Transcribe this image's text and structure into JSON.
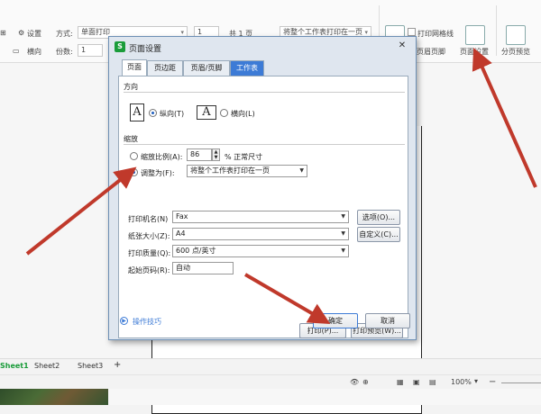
{
  "ribbon": {
    "settings_label": "设置",
    "landscape_label": "横向",
    "mode_label": "方式:",
    "mode_value": "单面打印",
    "copies_label": "份数:",
    "copies_value": "1",
    "page_from": "1",
    "page_total": "共 1 页",
    "fit_value": "将整个工作表打印在一页",
    "gridlines_label": "打印网格线",
    "header_footer_label": "页眉页脚",
    "page_setup_label": "页面设置",
    "page_break_label": "分页预览"
  },
  "dialog": {
    "logo": "S",
    "title": "页面设置",
    "close": "✕",
    "tabs": [
      "页面",
      "页边距",
      "页眉/页脚",
      "工作表"
    ],
    "orientation": {
      "label": "方向",
      "portrait": "纵向(T)",
      "landscape": "横向(L)",
      "icon_letter": "A"
    },
    "scaling": {
      "label": "缩放",
      "scale_label": "缩放比例(A):",
      "scale_value": "86",
      "scale_suffix": "% 正常尺寸",
      "fit_label": "调整为(F):",
      "fit_value": "将整个工作表打印在一页"
    },
    "printer": {
      "name_label": "打印机名(N)",
      "name_value": "Fax",
      "options_btn": "选项(O)...",
      "paper_label": "纸张大小(Z):",
      "paper_value": "A4",
      "custom_btn": "自定义(C)...",
      "quality_label": "打印质量(Q):",
      "quality_value": "600 点/英寸",
      "first_page_label": "起始页码(R):",
      "first_page_value": "自动"
    },
    "print_btn": "打印(P)...",
    "preview_btn": "打印预览(W)...",
    "tips_link": "操作技巧",
    "ok_btn": "确定",
    "cancel_btn": "取消"
  },
  "sheets": {
    "tabs": [
      "Sheet1",
      "Sheet2",
      "Sheet3"
    ],
    "add": "+"
  },
  "status": {
    "zoom": "100%",
    "minus": "−"
  },
  "colors": {
    "arrow": "#c0392b",
    "wps_green": "#1a9c3a",
    "accent_blue": "#3d7bd6"
  }
}
